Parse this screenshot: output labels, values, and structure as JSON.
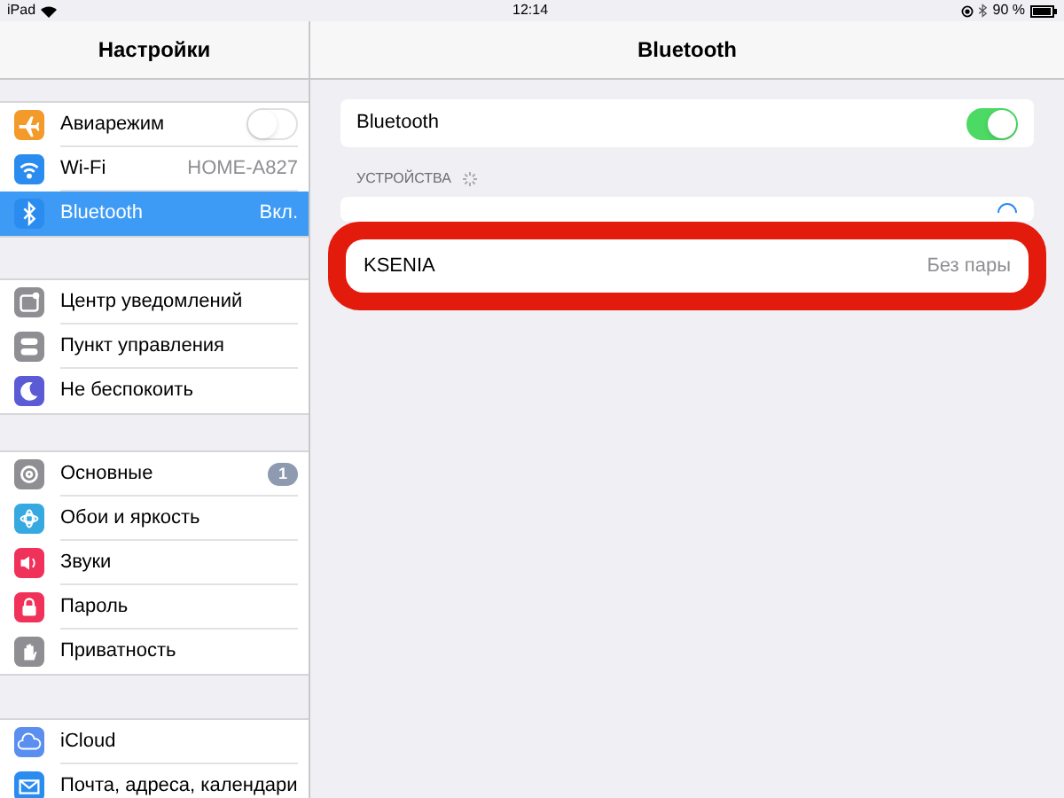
{
  "status_bar": {
    "device": "iPad",
    "time": "12:14",
    "battery": "90 %"
  },
  "sidebar": {
    "title": "Настройки",
    "groups": [
      [
        {
          "label": "Авиарежим",
          "color": "#f39a2a",
          "kind": "toggle",
          "on": false,
          "selected": false
        },
        {
          "label": "Wi-Fi",
          "color": "#2b8cf0",
          "kind": "value",
          "value": "HOME-A827",
          "selected": false
        },
        {
          "label": "Bluetooth",
          "color": "#2b8cf0",
          "kind": "value",
          "value": "Вкл.",
          "selected": true
        }
      ],
      [
        {
          "label": "Центр уведомлений",
          "color": "#8e8e93",
          "kind": "plain",
          "selected": false
        },
        {
          "label": "Пункт управления",
          "color": "#8e8e93",
          "kind": "plain",
          "selected": false
        },
        {
          "label": "Не беспокоить",
          "color": "#5b5bd6",
          "kind": "plain",
          "selected": false
        }
      ],
      [
        {
          "label": "Основные",
          "color": "#8e8e93",
          "kind": "badge",
          "value": "1",
          "selected": false
        },
        {
          "label": "Обои и яркость",
          "color": "#36a9e0",
          "kind": "plain",
          "selected": false
        },
        {
          "label": "Звуки",
          "color": "#f0325a",
          "kind": "plain",
          "selected": false
        },
        {
          "label": "Пароль",
          "color": "#f0325a",
          "kind": "plain",
          "selected": false
        },
        {
          "label": "Приватность",
          "color": "#8e8e93",
          "kind": "plain",
          "selected": false
        }
      ],
      [
        {
          "label": "iCloud",
          "color": "#5a8ff0",
          "kind": "plain",
          "selected": false
        },
        {
          "label": "Почта, адреса, календари",
          "color": "#2b8cf0",
          "kind": "plain",
          "selected": false
        }
      ]
    ]
  },
  "detail": {
    "title": "Bluetooth",
    "toggle": {
      "label": "Bluetooth",
      "on": true
    },
    "section_header": "УСТРОЙСТВА",
    "devices": [
      {
        "name": "KSENIA",
        "status": "Без пары"
      }
    ]
  }
}
